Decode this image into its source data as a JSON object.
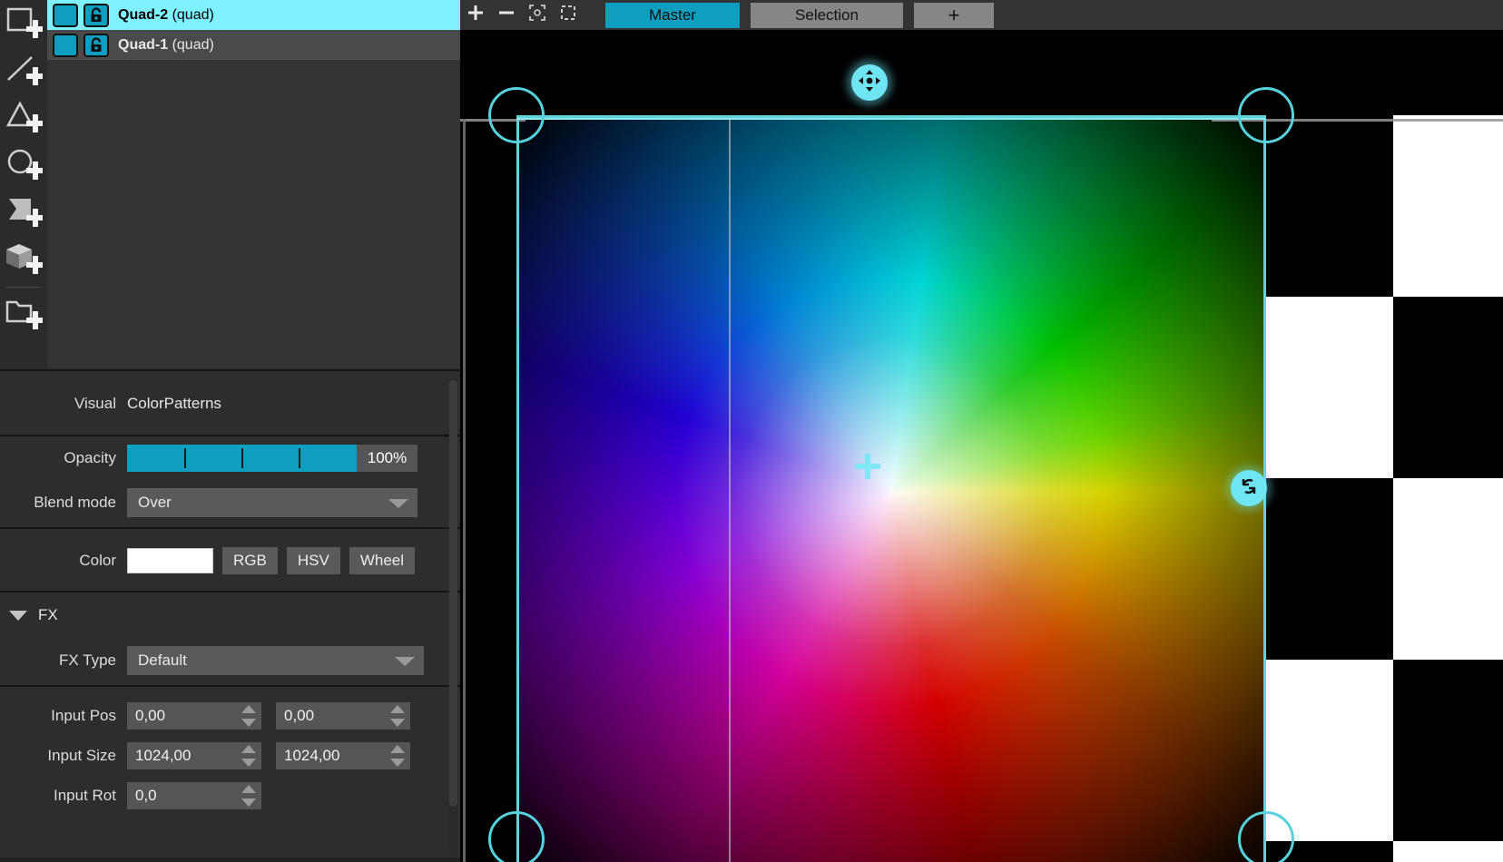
{
  "app": {
    "accent_cyan": "#0e9fc0",
    "selection_cyan": "#7ff2ff",
    "panel_bg": "#2d2d2d",
    "handle_cyan": "#6fe4f2"
  },
  "toolbar": {
    "tools": [
      {
        "name": "add-rectangle-tool",
        "icon": "rectangle-plus-icon",
        "title": "Add Rectangle"
      },
      {
        "name": "add-line-tool",
        "icon": "line-plus-icon",
        "title": "Add Line"
      },
      {
        "name": "add-triangle-tool",
        "icon": "triangle-plus-icon",
        "title": "Add Triangle"
      },
      {
        "name": "add-circle-tool",
        "icon": "circle-plus-icon",
        "title": "Add Circle"
      },
      {
        "name": "add-polygon-tool",
        "icon": "polygon-plus-icon",
        "title": "Add Polygon"
      },
      {
        "name": "add-cube-tool",
        "icon": "cube-plus-icon",
        "title": "Add Cube"
      },
      {
        "name": "add-folder-tool",
        "icon": "folder-plus-icon",
        "title": "Add Folder"
      }
    ]
  },
  "layers": [
    {
      "name": "Quad-2",
      "type": "(quad)",
      "selected": true,
      "visible": true,
      "locked": true
    },
    {
      "name": "Quad-1",
      "type": "(quad)",
      "selected": false,
      "visible": true,
      "locked": true
    }
  ],
  "viewport_toolbar": {
    "buttons": [
      {
        "name": "add-button",
        "icon": "plus-icon"
      },
      {
        "name": "remove-button",
        "icon": "minus-icon"
      },
      {
        "name": "fit-button",
        "icon": "fit-screen-icon"
      },
      {
        "name": "select-all-button",
        "icon": "dashed-square-icon"
      }
    ],
    "tabs": [
      {
        "label": "Master",
        "active": true
      },
      {
        "label": "Selection",
        "active": false
      }
    ],
    "add_tab_label": "+"
  },
  "properties": {
    "visual": {
      "label": "Visual",
      "value": "ColorPatterns"
    },
    "opacity": {
      "label": "Opacity",
      "value": "100%",
      "percent": 100
    },
    "blend_mode": {
      "label": "Blend mode",
      "value": "Over"
    },
    "color": {
      "label": "Color",
      "swatch": "#ffffff",
      "buttons": [
        "RGB",
        "HSV",
        "Wheel"
      ]
    },
    "fx": {
      "header": "FX",
      "expanded": true,
      "type_label": "FX Type",
      "type_value": "Default"
    },
    "transform": {
      "input_pos": {
        "label": "Input Pos",
        "x": "0,00",
        "y": "0,00"
      },
      "input_size": {
        "label": "Input Size",
        "x": "1024,00",
        "y": "1024,00"
      },
      "input_rot": {
        "label": "Input Rot",
        "value": "0,0"
      }
    }
  },
  "canvas": {
    "handles": [
      {
        "name": "move-handle",
        "icon": "move-4way-icon"
      },
      {
        "name": "rotate-handle",
        "icon": "rotate-icon"
      },
      {
        "name": "center-crosshair",
        "icon": "crosshair-icon"
      }
    ],
    "corner_handle_name": "corner-resize-handle"
  }
}
